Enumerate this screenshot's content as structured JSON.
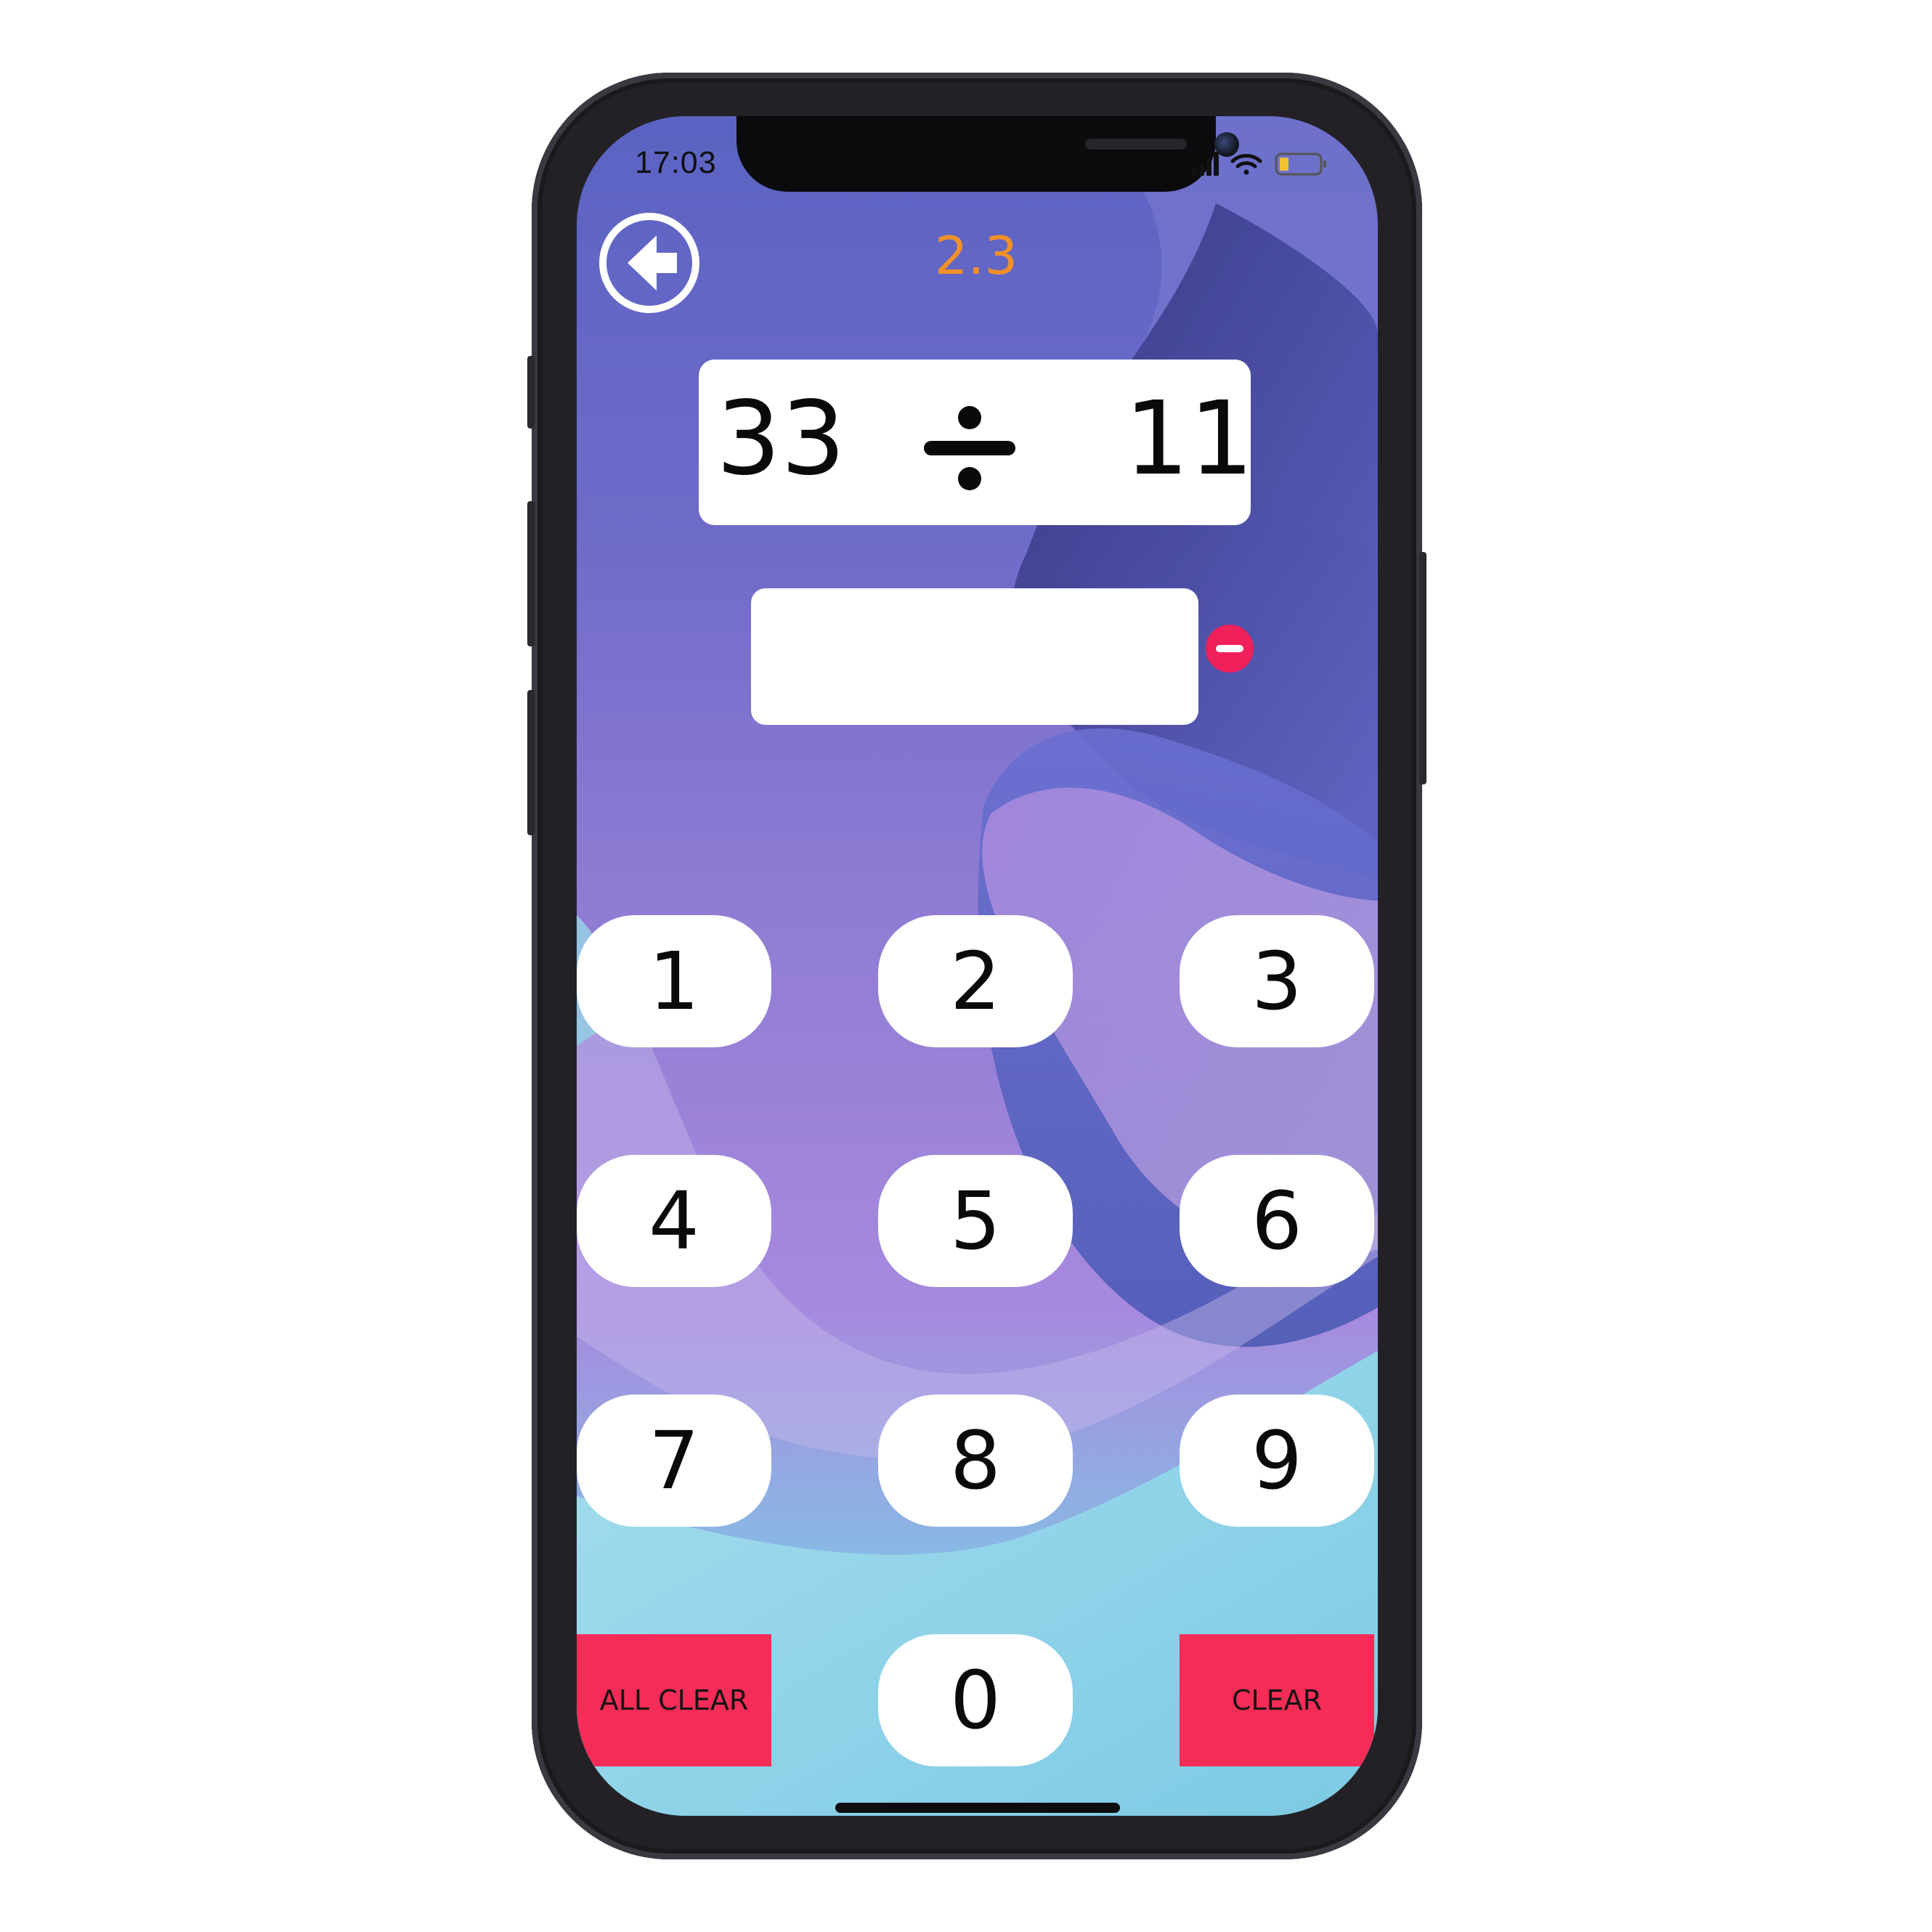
{
  "status_bar": {
    "time": "17:03",
    "icons": [
      "signal-icon",
      "wifi-icon",
      "battery-icon"
    ]
  },
  "header": {
    "back_icon": "back-arrow-icon",
    "level": "2.3",
    "level_color": "#f0902a"
  },
  "question": {
    "left_operand": "33",
    "operator_icon": "divide-icon",
    "right_operand": "11"
  },
  "answer": {
    "value": "",
    "negate_icon": "minus-icon",
    "negate_color": "#f0205a"
  },
  "keypad": {
    "keys": [
      "1",
      "2",
      "3",
      "4",
      "5",
      "6",
      "7",
      "8",
      "9"
    ],
    "zero": "0",
    "all_clear": "ALL CLEAR",
    "clear": "CLEAR",
    "clear_color": "#f42c57"
  }
}
